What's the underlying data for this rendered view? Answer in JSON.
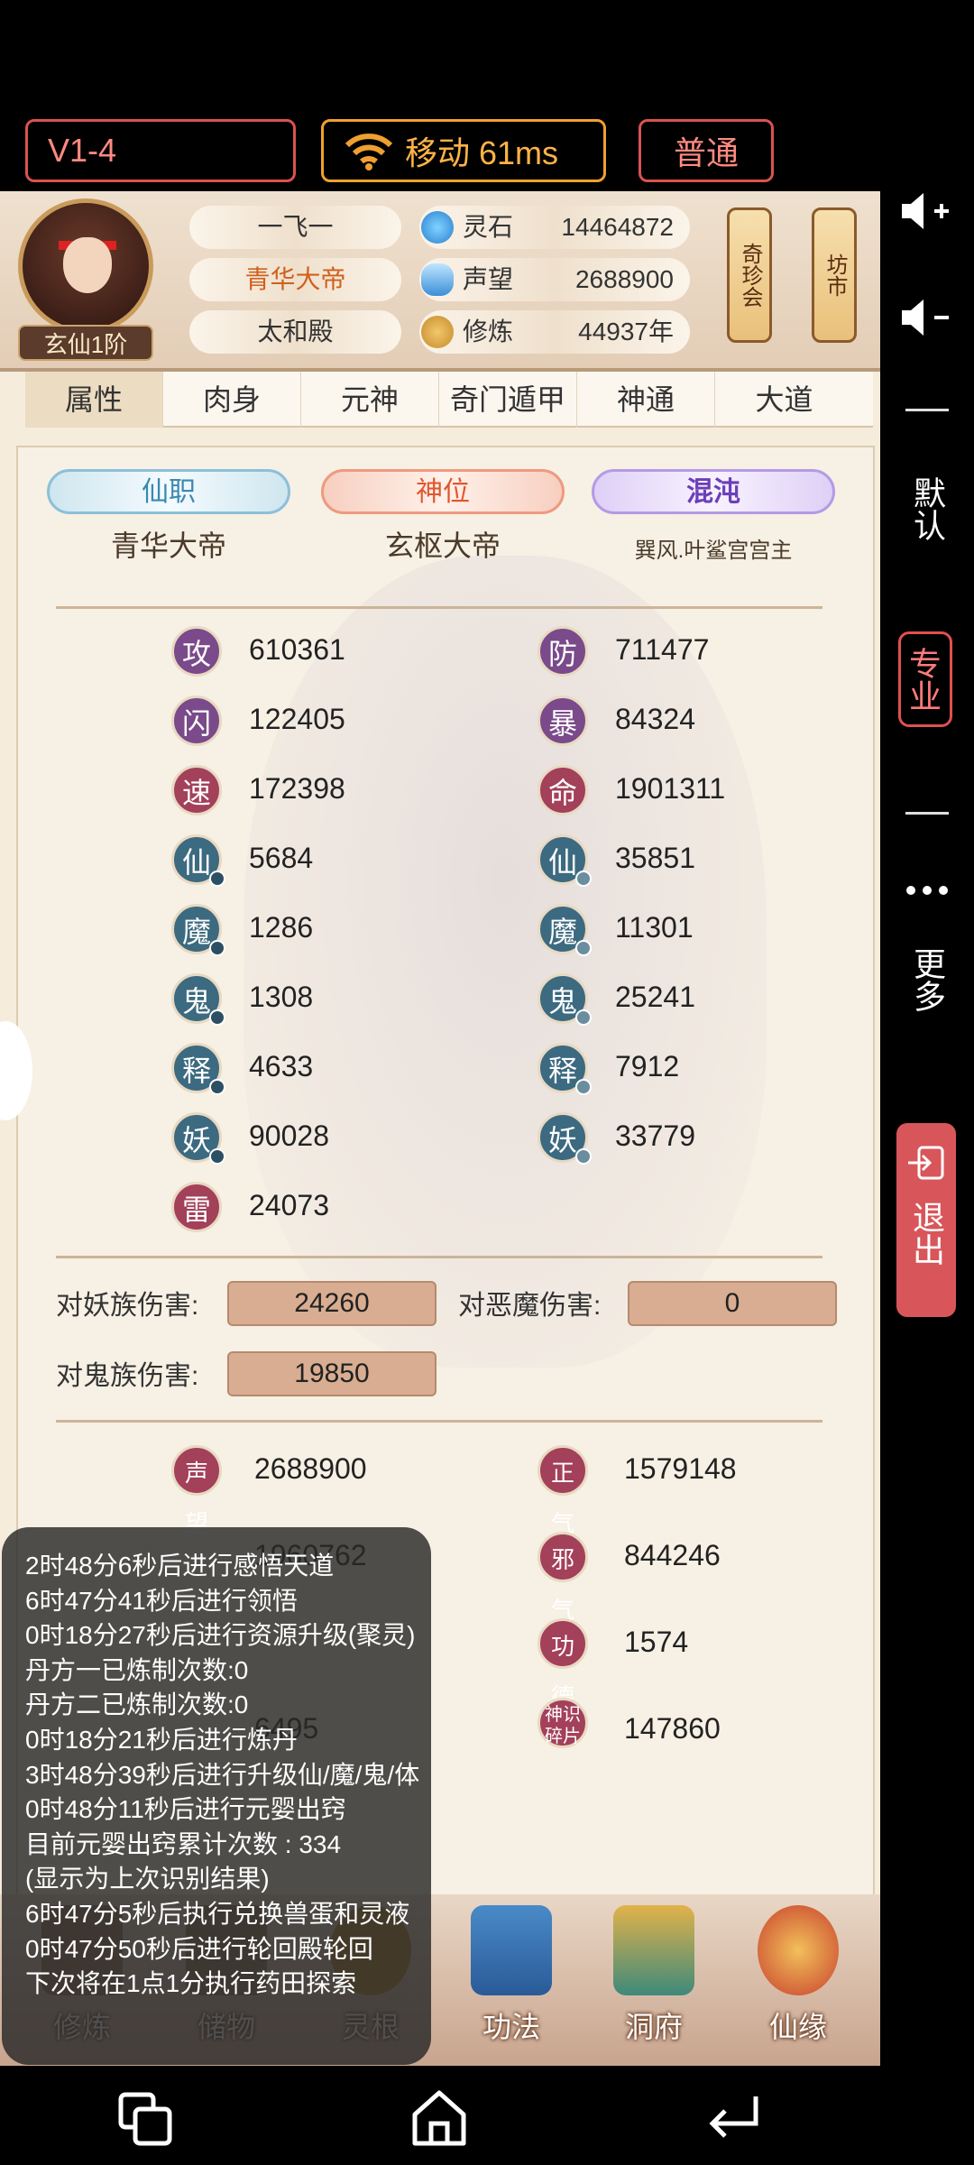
{
  "toolbar": {
    "version": "V1-4",
    "network": "移动 61ms",
    "mode": "普通"
  },
  "sidebar": {
    "volume_up": "volume-up-icon",
    "volume_down": "volume-down-icon",
    "default": "默认",
    "pro": "专业",
    "more": "更多",
    "exit": "退出"
  },
  "header": {
    "rank": "玄仙1阶",
    "name": "一飞一",
    "title": "青华大帝",
    "palace": "太和殿",
    "resources": [
      {
        "label": "灵石",
        "value": "14464872"
      },
      {
        "label": "声望",
        "value": "2688900"
      },
      {
        "label": "修炼",
        "value": "44937年"
      }
    ],
    "lanterns": [
      "奇珍会",
      "坊市"
    ]
  },
  "tabs": [
    "属性",
    "肉身",
    "元神",
    "奇门遁甲",
    "神通",
    "大道"
  ],
  "positions": [
    {
      "label": "仙职",
      "value": "青华大帝"
    },
    {
      "label": "神位",
      "value": "玄枢大帝"
    },
    {
      "label": "混沌",
      "value": "巽风.叶鲨宫宫主"
    }
  ],
  "stats_left": [
    {
      "icon": "攻",
      "value": "610361"
    },
    {
      "icon": "闪",
      "value": "122405"
    },
    {
      "icon": "速",
      "value": "172398"
    },
    {
      "icon": "仙",
      "value": "5684"
    },
    {
      "icon": "魔",
      "value": "1286"
    },
    {
      "icon": "鬼",
      "value": "1308"
    },
    {
      "icon": "释",
      "value": "4633"
    },
    {
      "icon": "妖",
      "value": "90028"
    },
    {
      "icon": "雷",
      "value": "24073"
    }
  ],
  "stats_right": [
    {
      "icon": "防",
      "value": "711477"
    },
    {
      "icon": "暴",
      "value": "84324"
    },
    {
      "icon": "命",
      "value": "1901311"
    },
    {
      "icon": "仙",
      "value": "35851"
    },
    {
      "icon": "魔",
      "value": "11301"
    },
    {
      "icon": "鬼",
      "value": "25241"
    },
    {
      "icon": "释",
      "value": "7912"
    },
    {
      "icon": "妖",
      "value": "33779"
    }
  ],
  "damage": [
    {
      "label": "对妖族伤害:",
      "value": "24260"
    },
    {
      "label": "对恶魔伤害:",
      "value": "0"
    },
    {
      "label": "对鬼族伤害:",
      "value": "19850"
    }
  ],
  "misc_left": [
    {
      "icon": "声望",
      "value": "2688900"
    },
    {
      "icon": "",
      "value": "1960762"
    },
    {
      "icon": "",
      "value": ""
    },
    {
      "icon": "",
      "value": "6495"
    }
  ],
  "misc_right": [
    {
      "icon": "正气",
      "value": "1579148"
    },
    {
      "icon": "邪气",
      "value": "844246"
    },
    {
      "icon": "功德",
      "value": "1574"
    },
    {
      "icon": "神识碎片",
      "value": "147860"
    }
  ],
  "bottom_nav": [
    "修炼",
    "储物",
    "灵根",
    "功法",
    "洞府",
    "仙缘"
  ],
  "log": [
    "2时48分6秒后进行感悟天道",
    "6时47分41秒后进行领悟",
    "0时18分27秒后进行资源升级(聚灵)",
    "丹方一已炼制次数:0",
    "丹方二已炼制次数:0",
    "0时18分21秒后进行炼丹",
    "3时48分39秒后进行升级仙/魔/鬼/体",
    "0时48分11秒后进行元婴出窍",
    "目前元婴出窍累计次数 : 334",
    "(显示为上次识别结果)",
    "6时47分5秒后执行兑换兽蛋和灵液",
    "0时47分50秒后进行轮回殿轮回",
    "下次将在1点1分执行药田探索"
  ],
  "navbar": {
    "recent": "recent-apps-icon",
    "home": "home-icon",
    "back": "back-icon"
  },
  "colors": {
    "accent_red": "#d9534f",
    "network_orange": "#f0a030",
    "exit_red": "#d8565a"
  }
}
